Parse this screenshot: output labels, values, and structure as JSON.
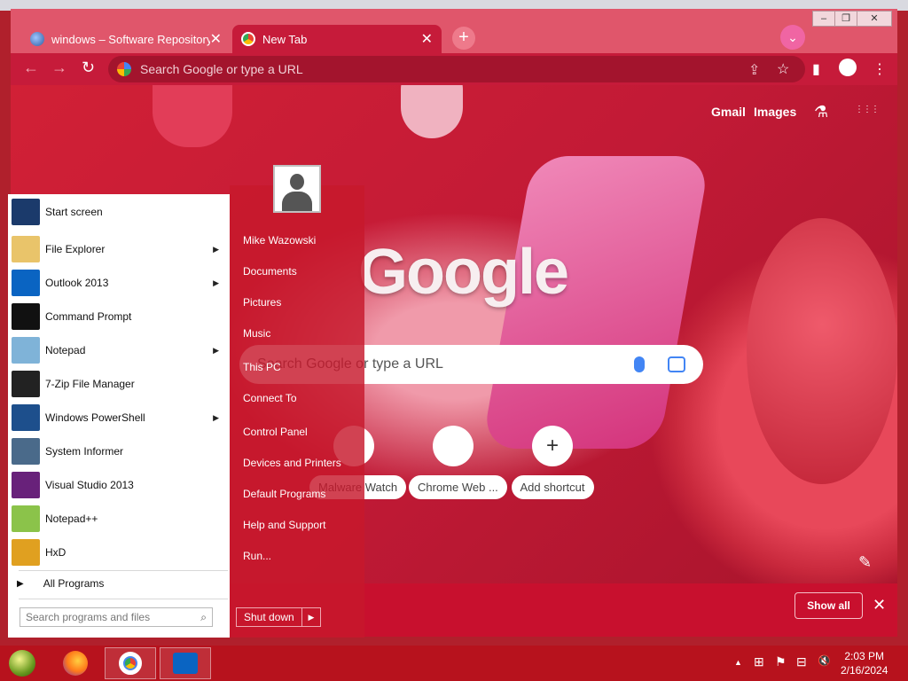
{
  "browser": {
    "tabs": [
      {
        "label": "windows – Software Repository",
        "close": "✕"
      },
      {
        "label": "New Tab",
        "close": "✕"
      }
    ],
    "new_tab_symbol": "+",
    "tab_search_symbol": "⌄",
    "window_controls": [
      "–",
      "❐",
      "✕"
    ],
    "nav": {
      "back": "←",
      "forward": "→",
      "reload": "↻"
    },
    "omnibox_placeholder": "Search Google or type a URL",
    "toolbar_icons": {
      "share": "⇪",
      "bookmark": "☆",
      "sidepanel": "▮",
      "menu": "⋮"
    }
  },
  "ntp": {
    "gmail": "Gmail",
    "images": "Images",
    "labs_icon": "⚗",
    "apps_icon": "⋮⋮⋮",
    "logo": "Google",
    "search_placeholder": "Search Google or type a URL",
    "shortcuts": [
      {
        "label": "Malware Watch",
        "glyph": ""
      },
      {
        "label": "Chrome Web ...",
        "glyph": ""
      },
      {
        "label": "Add shortcut",
        "glyph": "+"
      }
    ],
    "edit_icon": "✎",
    "show_all": "Show all",
    "close_bar": "✕"
  },
  "start_menu": {
    "programs": [
      {
        "label": "Start screen",
        "arrow": false,
        "icon": "start-screen-icon",
        "color": "#1b3a6b"
      },
      {
        "label": "File Explorer",
        "arrow": true,
        "icon": "folder-icon",
        "color": "#e9c46a"
      },
      {
        "label": "Outlook 2013",
        "arrow": true,
        "icon": "outlook-icon",
        "color": "#0a64c2"
      },
      {
        "label": "Command Prompt",
        "arrow": false,
        "icon": "terminal-icon",
        "color": "#111111"
      },
      {
        "label": "Notepad",
        "arrow": true,
        "icon": "notepad-icon",
        "color": "#7fb3d8"
      },
      {
        "label": "7-Zip File Manager",
        "arrow": false,
        "icon": "7zip-icon",
        "color": "#222222"
      },
      {
        "label": "Windows PowerShell",
        "arrow": true,
        "icon": "powershell-icon",
        "color": "#1d4f8c"
      },
      {
        "label": "System Informer",
        "arrow": false,
        "icon": "monitor-icon",
        "color": "#4a6a8a"
      },
      {
        "label": "Visual Studio 2013",
        "arrow": false,
        "icon": "visual-studio-icon",
        "color": "#68217a"
      },
      {
        "label": "Notepad++",
        "arrow": false,
        "icon": "notepadpp-icon",
        "color": "#8bc34a"
      },
      {
        "label": "HxD",
        "arrow": false,
        "icon": "hxd-icon",
        "color": "#e0a020"
      }
    ],
    "all_programs": "All Programs",
    "search_placeholder": "Search programs and files",
    "user_name": "Mike Wazowski",
    "links": [
      "Documents",
      "Pictures",
      "Music",
      "This PC",
      "Connect To",
      "Control Panel",
      "Devices and Printers",
      "Default Programs",
      "Help and Support",
      "Run..."
    ],
    "shutdown": "Shut down",
    "shutdown_arrow": "▶"
  },
  "taskbar": {
    "clock_time": "2:03 PM",
    "clock_date": "2/16/2024",
    "tray": {
      "up": "▲",
      "network": "⊞",
      "flag": "⚑",
      "monitor": "⊟",
      "volume": "🔇"
    }
  }
}
